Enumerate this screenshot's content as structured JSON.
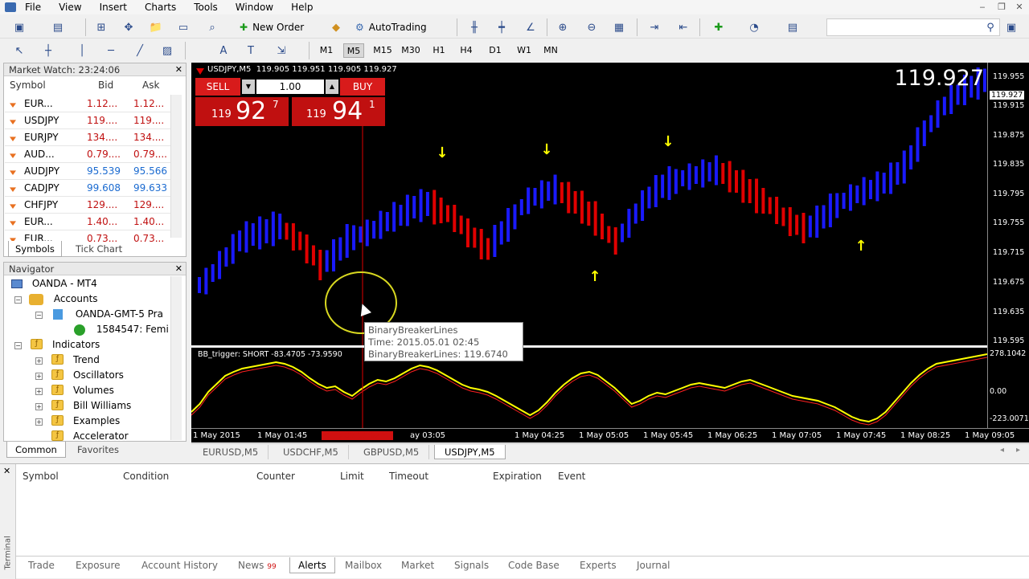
{
  "menu": [
    "File",
    "View",
    "Insert",
    "Charts",
    "Tools",
    "Window",
    "Help"
  ],
  "toolbar": {
    "new_order": "New Order",
    "autotrading": "AutoTrading"
  },
  "timeframes": [
    "M1",
    "M5",
    "M15",
    "M30",
    "H1",
    "H4",
    "D1",
    "W1",
    "MN"
  ],
  "active_timeframe": "M5",
  "market_watch": {
    "title": "Market Watch: 23:24:06",
    "headers": {
      "symbol": "Symbol",
      "bid": "Bid",
      "ask": "Ask"
    },
    "rows": [
      {
        "symbol": "EUR...",
        "bid": "1.12...",
        "ask": "1.12...",
        "dir": "down"
      },
      {
        "symbol": "USDJPY",
        "bid": "119....",
        "ask": "119....",
        "dir": "down"
      },
      {
        "symbol": "EURJPY",
        "bid": "134....",
        "ask": "134....",
        "dir": "down"
      },
      {
        "symbol": "AUD...",
        "bid": "0.79....",
        "ask": "0.79....",
        "dir": "down"
      },
      {
        "symbol": "AUDJPY",
        "bid": "95.539",
        "ask": "95.566",
        "dir": "down"
      },
      {
        "symbol": "CADJPY",
        "bid": "99.608",
        "ask": "99.633",
        "dir": "down"
      },
      {
        "symbol": "CHFJPY",
        "bid": "129....",
        "ask": "129....",
        "dir": "down"
      },
      {
        "symbol": "EUR...",
        "bid": "1.40...",
        "ask": "1.40...",
        "dir": "down"
      },
      {
        "symbol": "EUR...",
        "bid": "0.73...",
        "ask": "0.73...",
        "dir": "down"
      }
    ],
    "tabs": [
      "Symbols",
      "Tick Chart"
    ]
  },
  "navigator": {
    "title": "Navigator",
    "items": [
      {
        "label": "OANDA - MT4"
      },
      {
        "label": "Accounts"
      },
      {
        "label": "OANDA-GMT-5 Pra"
      },
      {
        "label": "1584547: Femi"
      },
      {
        "label": "Indicators"
      },
      {
        "label": "Trend"
      },
      {
        "label": "Oscillators"
      },
      {
        "label": "Volumes"
      },
      {
        "label": "Bill Williams"
      },
      {
        "label": "Examples"
      },
      {
        "label": "Accelerator"
      }
    ],
    "tabs": [
      "Common",
      "Favorites"
    ]
  },
  "chart": {
    "header": "USDJPY,M5  119.905 119.951 119.905 119.927",
    "big_price": "119.927",
    "one_click": {
      "sell": "SELL",
      "buy": "BUY",
      "lot": "1.00",
      "sell_big": "119",
      "sell_digits": "92",
      "sell_sup": "7",
      "buy_big": "119",
      "buy_digits": "94",
      "buy_sup": "1"
    },
    "tooltip": {
      "line1": "BinaryBreakerLines",
      "line2": "Time: 2015.05.01 02:45",
      "line3": "BinaryBreakerLines: 119.6740"
    },
    "indicator_label": "BB_trigger: SHORT -83.4705 -73.9590",
    "price_labels": [
      "119.955",
      "119.927",
      "119.915",
      "119.875",
      "119.835",
      "119.795",
      "119.755",
      "119.715",
      "119.675",
      "119.635",
      "119.595"
    ],
    "sub_labels": [
      "278.1042",
      "0.00",
      "-223.0071"
    ],
    "time_labels": [
      "1 May 2015",
      "1 May 01:45",
      "2015.05.01 02:45",
      "ay 03:05",
      "1 May 04:25",
      "1 May 05:05",
      "1 May 05:45",
      "1 May 06:25",
      "1 May 07:05",
      "1 May 07:45",
      "1 May 08:25",
      "1 May 09:05"
    ],
    "tabs": [
      "EURUSD,M5",
      "USDCHF,M5",
      "GBPUSD,M5",
      "USDJPY,M5"
    ]
  },
  "alerts": {
    "headers": [
      "Symbol",
      "Condition",
      "Counter",
      "Limit",
      "Timeout",
      "Expiration",
      "Event"
    ],
    "tabs": [
      "Trade",
      "Exposure",
      "Account History",
      "News",
      "Alerts",
      "Mailbox",
      "Market",
      "Signals",
      "Code Base",
      "Experts",
      "Journal"
    ],
    "news_badge": "99",
    "active_tab": "Alerts",
    "side_label": "Terminal"
  },
  "colors": {
    "bull": "#1a1aff",
    "bear": "#e00000",
    "arrow": "#ffff00",
    "osc": "#ffff00",
    "osc2": "#ff2020"
  }
}
